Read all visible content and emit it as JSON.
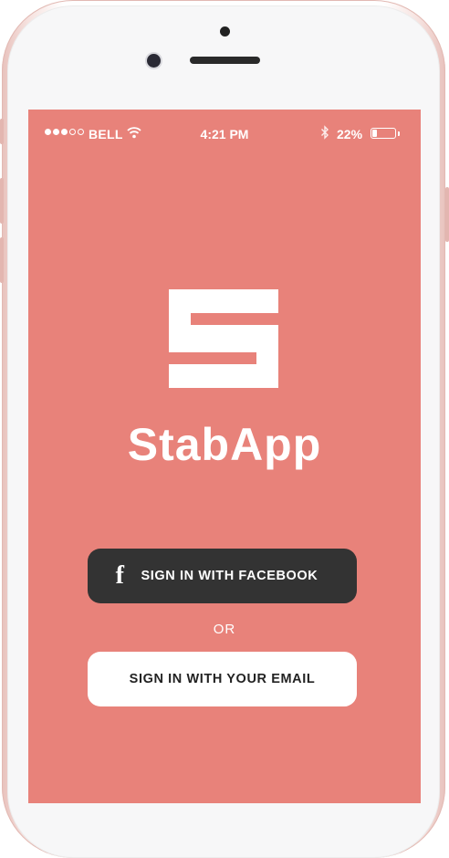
{
  "status_bar": {
    "carrier": "BELL",
    "time": "4:21 PM",
    "battery_percent": "22%",
    "signal_bars_filled": 3,
    "signal_bars_total": 5,
    "battery_level": 0.22
  },
  "app": {
    "name": "StabApp",
    "logo_letter": "S"
  },
  "buttons": {
    "facebook_label": "SIGN IN WITH FACEBOOK",
    "facebook_icon": "facebook-icon",
    "or_label": "OR",
    "email_label": "SIGN IN WITH YOUR EMAIL"
  },
  "colors": {
    "screen_background": "#e8827a",
    "facebook_button": "#333333",
    "email_button": "#ffffff",
    "phone_frame": "#f7f7f8"
  }
}
